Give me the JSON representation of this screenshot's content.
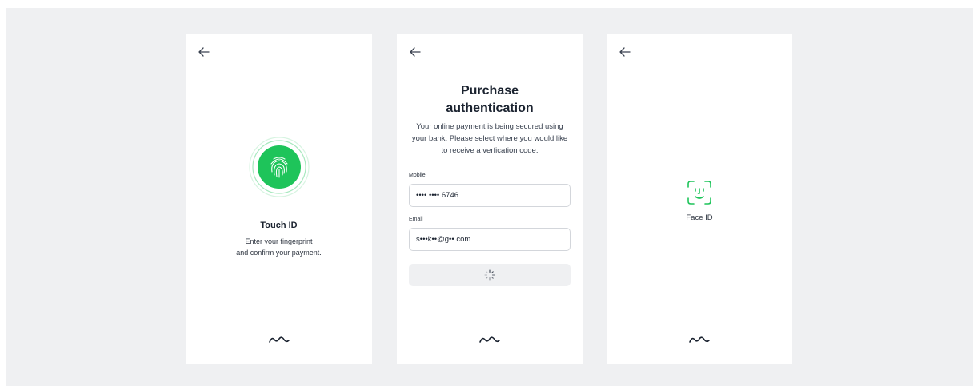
{
  "touch_id": {
    "title": "Touch ID",
    "subtitle_line1": "Enter your fingerprint",
    "subtitle_line2": "and confirm your payment."
  },
  "purchase": {
    "title_line1": "Purchase",
    "title_line2": "authentication",
    "desc_line1": "Your online payment is being secured using",
    "desc_line2": "your bank. Please select where you would like",
    "desc_line3": "to receive a verfication code.",
    "mobile_label": "Mobile",
    "mobile_value": "•••• •••• 6746",
    "email_label": "Email",
    "email_value": "s•••k••@g••.com"
  },
  "face_id": {
    "label": "Face ID"
  },
  "colors": {
    "accent_green": "#1ec45a",
    "background": "#eff0f2"
  },
  "icons": [
    "back-arrow-icon",
    "fingerprint-icon",
    "loading-spinner-icon",
    "face-id-icon",
    "brand-wave-logo-icon"
  ]
}
